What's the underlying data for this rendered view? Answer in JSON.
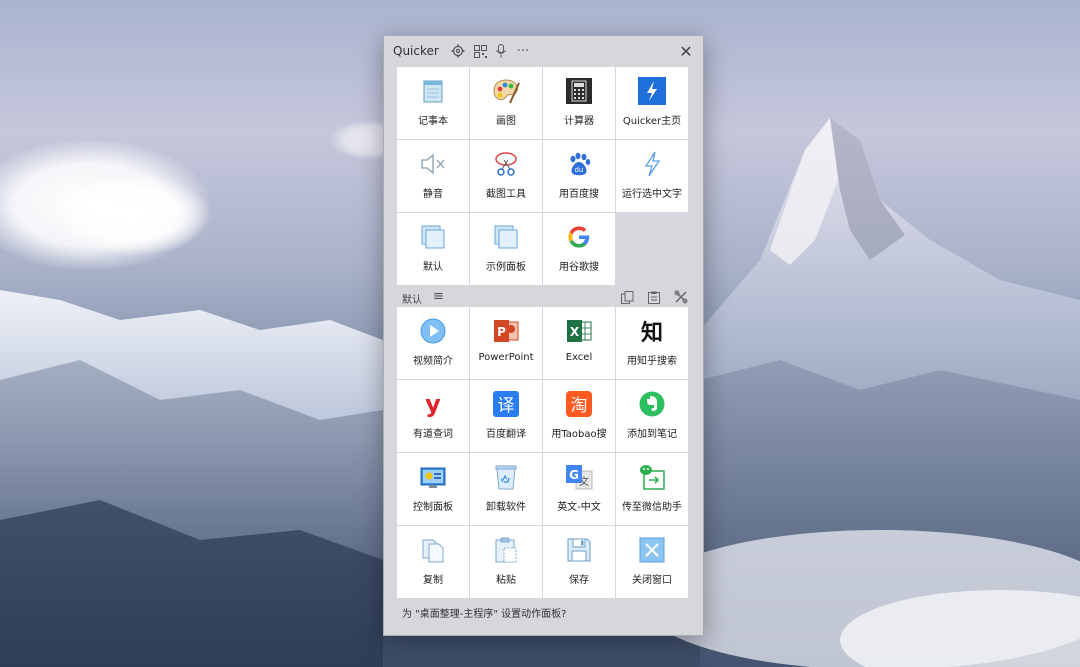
{
  "window": {
    "title": "Quicker",
    "close_glyph": "✕",
    "toolbar_icons": [
      "gear-icon",
      "qrcode-icon",
      "microphone-icon",
      "more-icon"
    ]
  },
  "top_panel": {
    "items": [
      {
        "label": "记事本",
        "icon": "notepad-icon"
      },
      {
        "label": "画图",
        "icon": "paint-palette-icon"
      },
      {
        "label": "计算器",
        "icon": "calculator-icon"
      },
      {
        "label": "Quicker主页",
        "icon": "quicker-lightning-icon"
      },
      {
        "label": "静音",
        "icon": "mute-speaker-icon"
      },
      {
        "label": "截图工具",
        "icon": "snipping-tool-icon"
      },
      {
        "label": "用百度搜",
        "icon": "baidu-icon"
      },
      {
        "label": "运行选中文字",
        "icon": "lightning-outline-icon"
      },
      {
        "label": "默认",
        "icon": "panel-icon"
      },
      {
        "label": "示例面板",
        "icon": "panel-icon"
      },
      {
        "label": "用谷歌搜",
        "icon": "google-icon"
      }
    ]
  },
  "section": {
    "label": "默认",
    "menu_glyph": "≡",
    "tools": [
      "copy-panel-icon",
      "paste-panel-icon",
      "edit-tools-icon"
    ]
  },
  "bottom_panel": {
    "items": [
      {
        "label": "视频简介",
        "icon": "play-video-icon"
      },
      {
        "label": "PowerPoint",
        "icon": "powerpoint-icon",
        "glyph": "P"
      },
      {
        "label": "Excel",
        "icon": "excel-icon",
        "glyph": "X"
      },
      {
        "label": "用知乎搜索",
        "icon": "zhihu-icon",
        "glyph": "知"
      },
      {
        "label": "有道查词",
        "icon": "youdao-icon",
        "glyph": "y"
      },
      {
        "label": "百度翻译",
        "icon": "baidu-translate-icon",
        "glyph": "译"
      },
      {
        "label": "用Taobao搜",
        "icon": "taobao-icon",
        "glyph": "淘"
      },
      {
        "label": "添加到笔记",
        "icon": "evernote-icon"
      },
      {
        "label": "控制面板",
        "icon": "control-panel-icon"
      },
      {
        "label": "卸载软件",
        "icon": "recycle-bin-icon"
      },
      {
        "label": "英文-中文",
        "icon": "google-translate-icon",
        "glyph": "G"
      },
      {
        "label": "传至微信助手",
        "icon": "wechat-transfer-icon"
      },
      {
        "label": "复制",
        "icon": "copy-icon"
      },
      {
        "label": "粘贴",
        "icon": "paste-icon"
      },
      {
        "label": "保存",
        "icon": "save-floppy-icon"
      },
      {
        "label": "关闭窗口",
        "icon": "close-window-icon"
      }
    ]
  },
  "footer": {
    "text": "为 \"桌面整理-主程序\" 设置动作面板?"
  },
  "colors": {
    "panel_bg": "#d6d7dc",
    "tile_bg": "#ffffff",
    "quicker_blue": "#1e6fd9",
    "powerpoint": "#d24726",
    "excel": "#1f7244",
    "youdao": "#e0242a",
    "baidu_translate": "#2b7cf0",
    "taobao": "#ff5a1f",
    "evernote": "#2dbe60"
  }
}
